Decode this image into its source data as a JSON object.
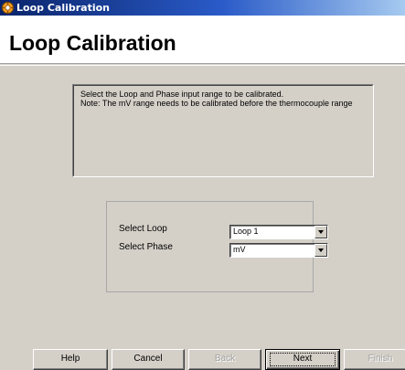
{
  "window": {
    "title": "Loop Calibration",
    "icon": "app-gear-icon"
  },
  "header": {
    "title": "Loop Calibration"
  },
  "info": {
    "line1": "Select the Loop and Phase input range to be calibrated.",
    "line2": "Note: The mV range needs to be calibrated before the thermocouple range"
  },
  "selectors": {
    "loop": {
      "label": "Select Loop",
      "value": "Loop 1"
    },
    "phase": {
      "label": "Select Phase",
      "value": "mV"
    }
  },
  "buttons": {
    "help": "Help",
    "cancel": "Cancel",
    "back": "Back",
    "next": "Next",
    "finish": "Finish"
  }
}
